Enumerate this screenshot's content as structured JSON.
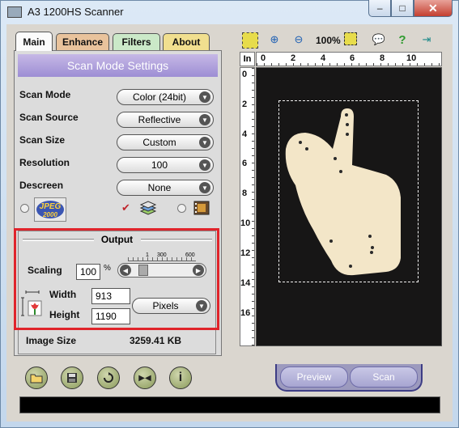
{
  "window": {
    "title": "A3 1200HS Scanner",
    "close_glyph": "✕",
    "max_glyph": "□",
    "min_glyph": "–"
  },
  "tabs": [
    "Main",
    "Enhance",
    "Filters",
    "About"
  ],
  "panel": {
    "header": "Scan Mode Settings",
    "rows": [
      {
        "label": "Scan Mode",
        "value": "Color (24bit)"
      },
      {
        "label": "Scan Source",
        "value": "Reflective"
      },
      {
        "label": "Scan Size",
        "value": "Custom"
      },
      {
        "label": "Resolution",
        "value": "100"
      },
      {
        "label": "Descreen",
        "value": "None"
      }
    ],
    "jpeg_badge": [
      "JPEG",
      "2000"
    ]
  },
  "output": {
    "title": "Output",
    "scaling_label": "Scaling",
    "scaling_value": "100",
    "scaling_unit": "%",
    "slider_ticks": [
      "1",
      "300",
      "600"
    ],
    "width_label": "Width",
    "width_value": "913",
    "height_label": "Height",
    "height_value": "1190",
    "unit_value": "Pixels",
    "image_size_label": "Image Size",
    "image_size_value": "3259.41 KB"
  },
  "toolbar": {
    "zoom_text": "100%"
  },
  "ruler": {
    "unit": "In",
    "top_ticks": [
      "0",
      "2",
      "4",
      "6",
      "8",
      "10"
    ],
    "left_ticks": [
      "0",
      "2",
      "4",
      "6",
      "8",
      "10",
      "12",
      "14",
      "16"
    ]
  },
  "buttons": {
    "preview": "Preview",
    "scan": "Scan"
  },
  "colors": {
    "highlight": "#e0242b",
    "header": "#9d8ed4",
    "preview_bg": "#171616",
    "paper": "#f3e6c8"
  }
}
